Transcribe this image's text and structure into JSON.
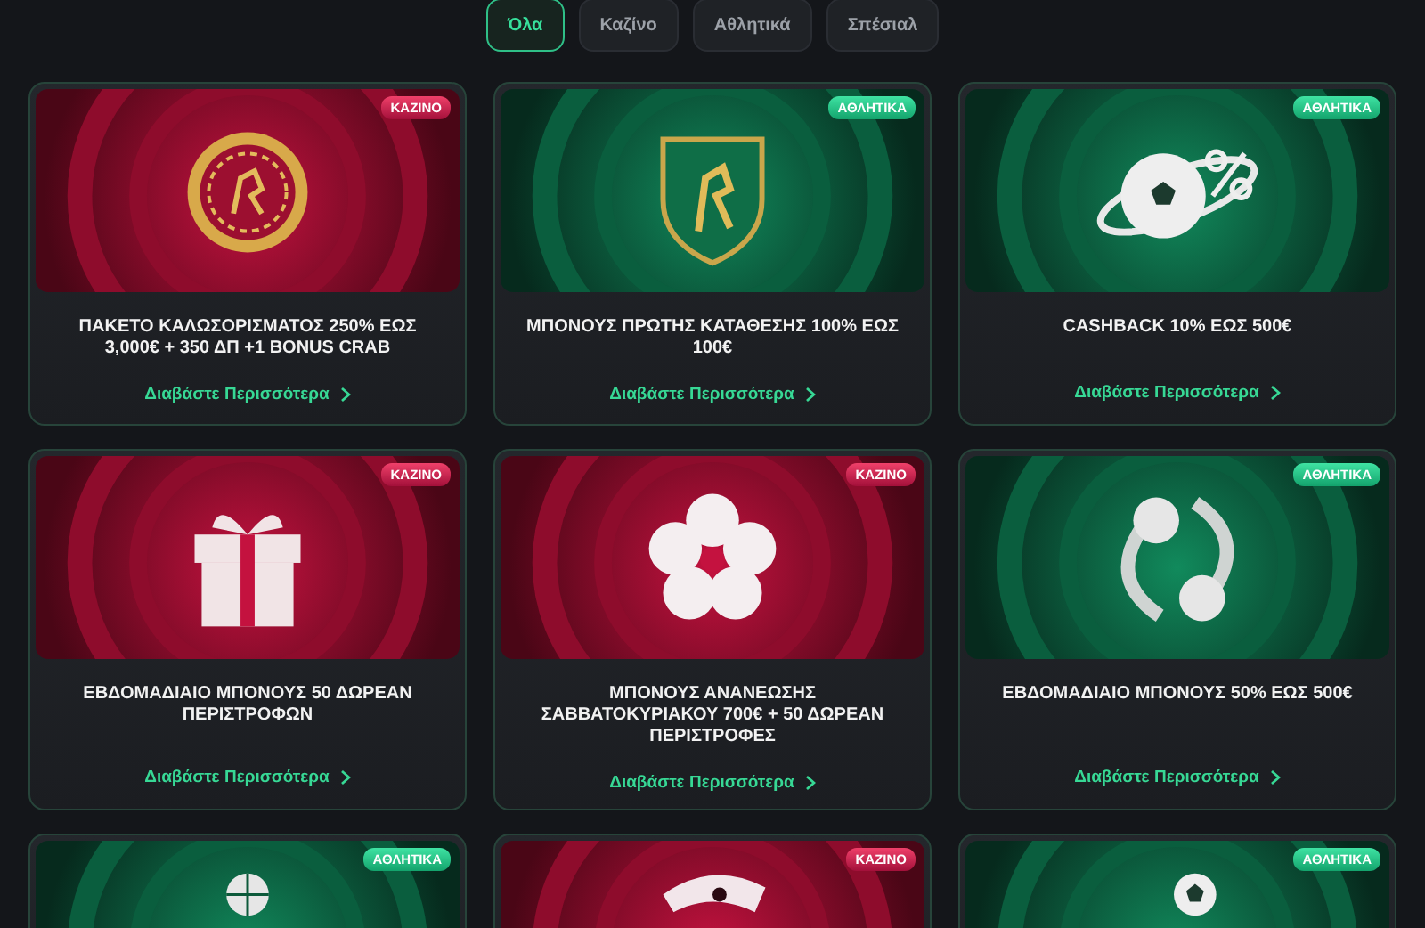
{
  "tabs": [
    {
      "label": "Όλα",
      "selected": true
    },
    {
      "label": "Καζίνο",
      "selected": false
    },
    {
      "label": "Αθλητικά",
      "selected": false
    },
    {
      "label": "Σπέσιαλ",
      "selected": false
    }
  ],
  "cards": [
    {
      "kind": "casino",
      "banner": {
        "kind": "chip"
      },
      "badge": "ΚΑΖΙΝΟ",
      "title": "ΠΑΚΕΤΟ ΚΑΛΩΣΟΡΙΣΜΑΤΟΣ 250% ΕΩΣ 3,000€ + 350 ΔΠ +1 BONUS CRAB",
      "link": "Διαβάστε Περισσότερα"
    },
    {
      "kind": "sports",
      "banner": {
        "kind": "shield"
      },
      "badge": "ΑΘΛΗΤΙΚΑ",
      "title": "ΜΠΟΝΟΥΣ ΠΡΩΤΗΣ ΚΑΤΑΘΕΣΗΣ 100% ΕΩΣ 100€",
      "link": "Διαβάστε Περισσότερα"
    },
    {
      "kind": "sports",
      "banner": {
        "kind": "ball-percent"
      },
      "badge": "ΑΘΛΗΤΙΚΑ",
      "title": "CASHBACK 10% ΕΩΣ 500€",
      "link": "Διαβάστε Περισσότερα"
    },
    {
      "kind": "casino",
      "banner": {
        "kind": "gift"
      },
      "badge": "ΚΑΖΙΝΟ",
      "title": "ΕΒΔΟΜΑΔΙΑΙΟ ΜΠΟΝΟΥΣ 50 ΔΩΡΕΑΝ ΠΕΡΙΣΤΡΟΦΩΝ",
      "link": "Διαβάστε Περισσότερα"
    },
    {
      "kind": "casino",
      "banner": {
        "kind": "flower"
      },
      "badge": "ΚΑΖΙΝΟ",
      "title": "ΜΠΟΝΟΥΣ ΑΝΑΝΕΩΣΗΣ ΣΑΒΒΑΤΟΚΥΡΙΑΚΟΥ 700€ + 50 ΔΩΡΕΑΝ ΠΕΡΙΣΤΡΟΦΕΣ",
      "link": "Διαβάστε Περισσότερα"
    },
    {
      "kind": "sports",
      "banner": {
        "kind": "tennis"
      },
      "badge": "ΑΘΛΗΤΙΚΑ",
      "title": "ΕΒΔΟΜΑΔΙΑΙΟ ΜΠΟΝΟΥΣ 50% ΕΩΣ 500€",
      "link": "Διαβάστε Περισσότερα"
    },
    {
      "kind": "sports",
      "banner": {
        "kind": "basketball"
      },
      "badge": "ΑΘΛΗΤΙΚΑ"
    },
    {
      "kind": "casino",
      "banner": {
        "kind": "percent"
      },
      "badge": "ΚΑΖΙΝΟ"
    },
    {
      "kind": "sports",
      "banner": {
        "kind": "soccer"
      },
      "badge": "ΑΘΛΗΤΙΚΑ"
    }
  ]
}
